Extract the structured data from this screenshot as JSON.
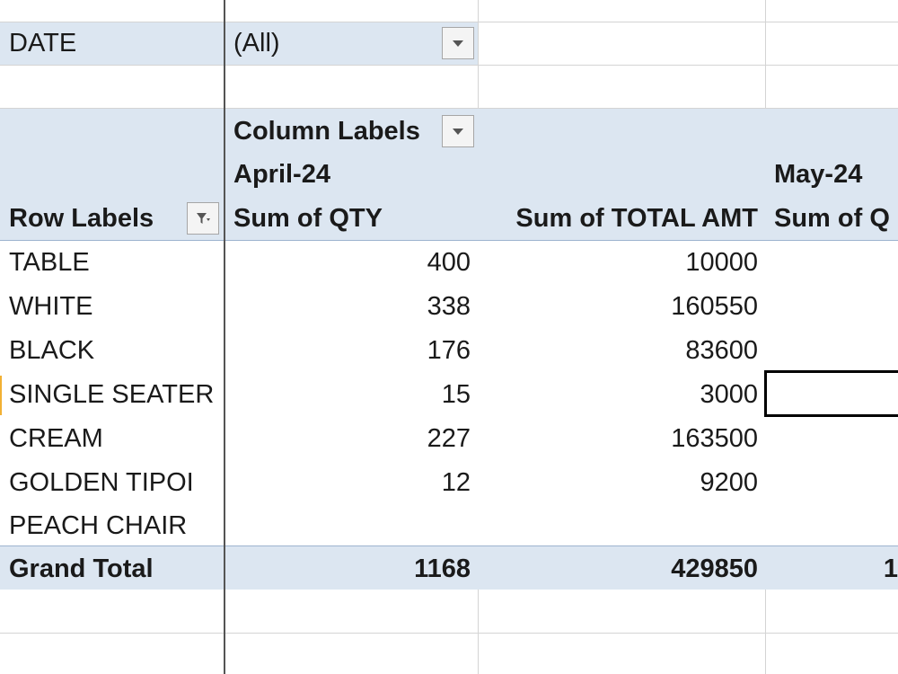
{
  "filter": {
    "label": "DATE",
    "value": "(All)"
  },
  "pivot": {
    "column_labels": "Column Labels",
    "row_labels": "Row Labels",
    "groups": [
      {
        "month": "April-24",
        "qty_header": "Sum of QTY",
        "amt_header": "Sum of TOTAL AMT"
      },
      {
        "month": "May-24",
        "qty_header": "Sum of Q"
      }
    ],
    "rows": [
      {
        "label": "TABLE",
        "qty": "400",
        "amt": "10000"
      },
      {
        "label": "WHITE",
        "qty": "338",
        "amt": "160550"
      },
      {
        "label": "BLACK",
        "qty": "176",
        "amt": "83600"
      },
      {
        "label": "SINGLE SEATER",
        "qty": "15",
        "amt": "3000"
      },
      {
        "label": "CREAM",
        "qty": "227",
        "amt": "163500"
      },
      {
        "label": "GOLDEN TIPOI",
        "qty": "12",
        "amt": "9200"
      },
      {
        "label": "PEACH CHAIR",
        "qty": "",
        "amt": ""
      }
    ],
    "grand_total": {
      "label": "Grand Total",
      "qty": "1168",
      "amt": "429850",
      "may_partial": "1"
    }
  },
  "icons": {
    "dropdown": "chevron-down-icon",
    "filter": "filter-icon"
  },
  "colors": {
    "header_band": "#dce6f1",
    "gridline": "#d4d4d4",
    "row_header_border": "#555555",
    "selection": "#000000"
  }
}
